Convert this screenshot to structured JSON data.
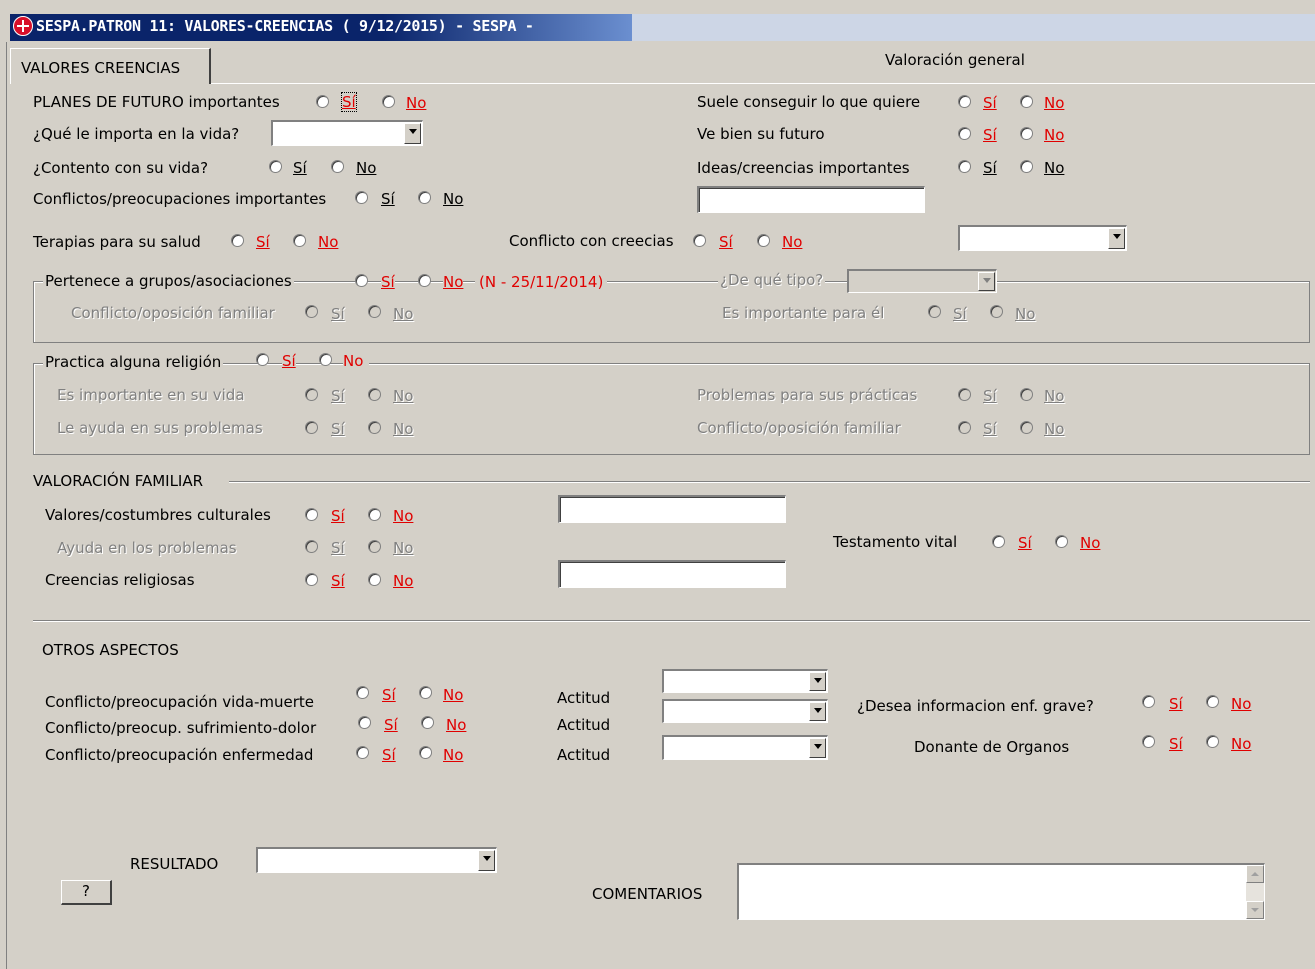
{
  "window": {
    "title": "SESPA.PATRON 11: VALORES-CREENCIAS ( 9/12/2015) - SESPA -"
  },
  "tab": {
    "label": "VALORES CREENCIAS"
  },
  "options": {
    "si": "Sí",
    "no": "No"
  },
  "general": {
    "heading": "Valoración general",
    "planes": "PLANES DE FUTURO importantes",
    "importa": "¿Qué le importa en la vida?",
    "contento": "¿Contento con su vida?",
    "conflictos": "Conflictos/preocupaciones importantes",
    "terapias": "Terapias para su salud",
    "conflicto_creencias": "Conflicto con creecias",
    "suele": "Suele conseguir lo que quiere",
    "futuro": "Ve bien su futuro",
    "ideas": "Ideas/creencias importantes"
  },
  "grupos": {
    "title": "Pertenece a grupos/asociaciones",
    "status": "(N - 25/11/2014)",
    "tipo": "¿De qué tipo?",
    "conflicto": "Conflicto/oposición familiar",
    "importante": "Es importante para él"
  },
  "religion": {
    "title": "Practica alguna religión",
    "importante": "Es importante en su vida",
    "ayuda": "Le ayuda en sus problemas",
    "problemas": "Problemas para sus prácticas",
    "conflicto": "Conflicto/oposición familiar"
  },
  "familiar": {
    "title": "VALORACIÓN FAMILIAR",
    "valores": "Valores/costumbres culturales",
    "ayuda": "Ayuda en los problemas",
    "creencias": "Creencias religiosas",
    "testamento": "Testamento vital"
  },
  "otros": {
    "title": "OTROS ASPECTOS",
    "vida_muerte": "Conflicto/preocupación vida-muerte",
    "sufrimiento": "Conflicto/preocup. sufrimiento-dolor",
    "enfermedad": "Conflicto/preocupación enfermedad",
    "actitud": "Actitud",
    "informacion": "¿Desea informacion enf. grave?",
    "donante": "Donante de Organos"
  },
  "bottom": {
    "resultado": "RESULTADO",
    "help": "?",
    "comentarios": "COMENTARIOS"
  },
  "colors": {
    "title_bg": "#0a246a",
    "window_bg": "#d4d0c8",
    "accent_red": "#e00000"
  }
}
